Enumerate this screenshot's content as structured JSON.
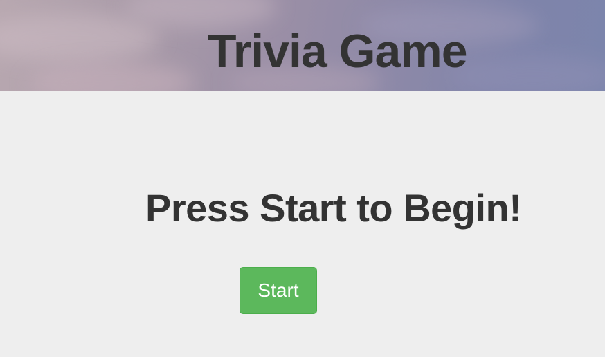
{
  "header": {
    "title": "Trivia Game"
  },
  "main": {
    "prompt": "Press Start to Begin!",
    "start_label": "Start"
  },
  "colors": {
    "background": "#eeeeee",
    "text": "#333333",
    "start_button": "#5cb85c"
  }
}
